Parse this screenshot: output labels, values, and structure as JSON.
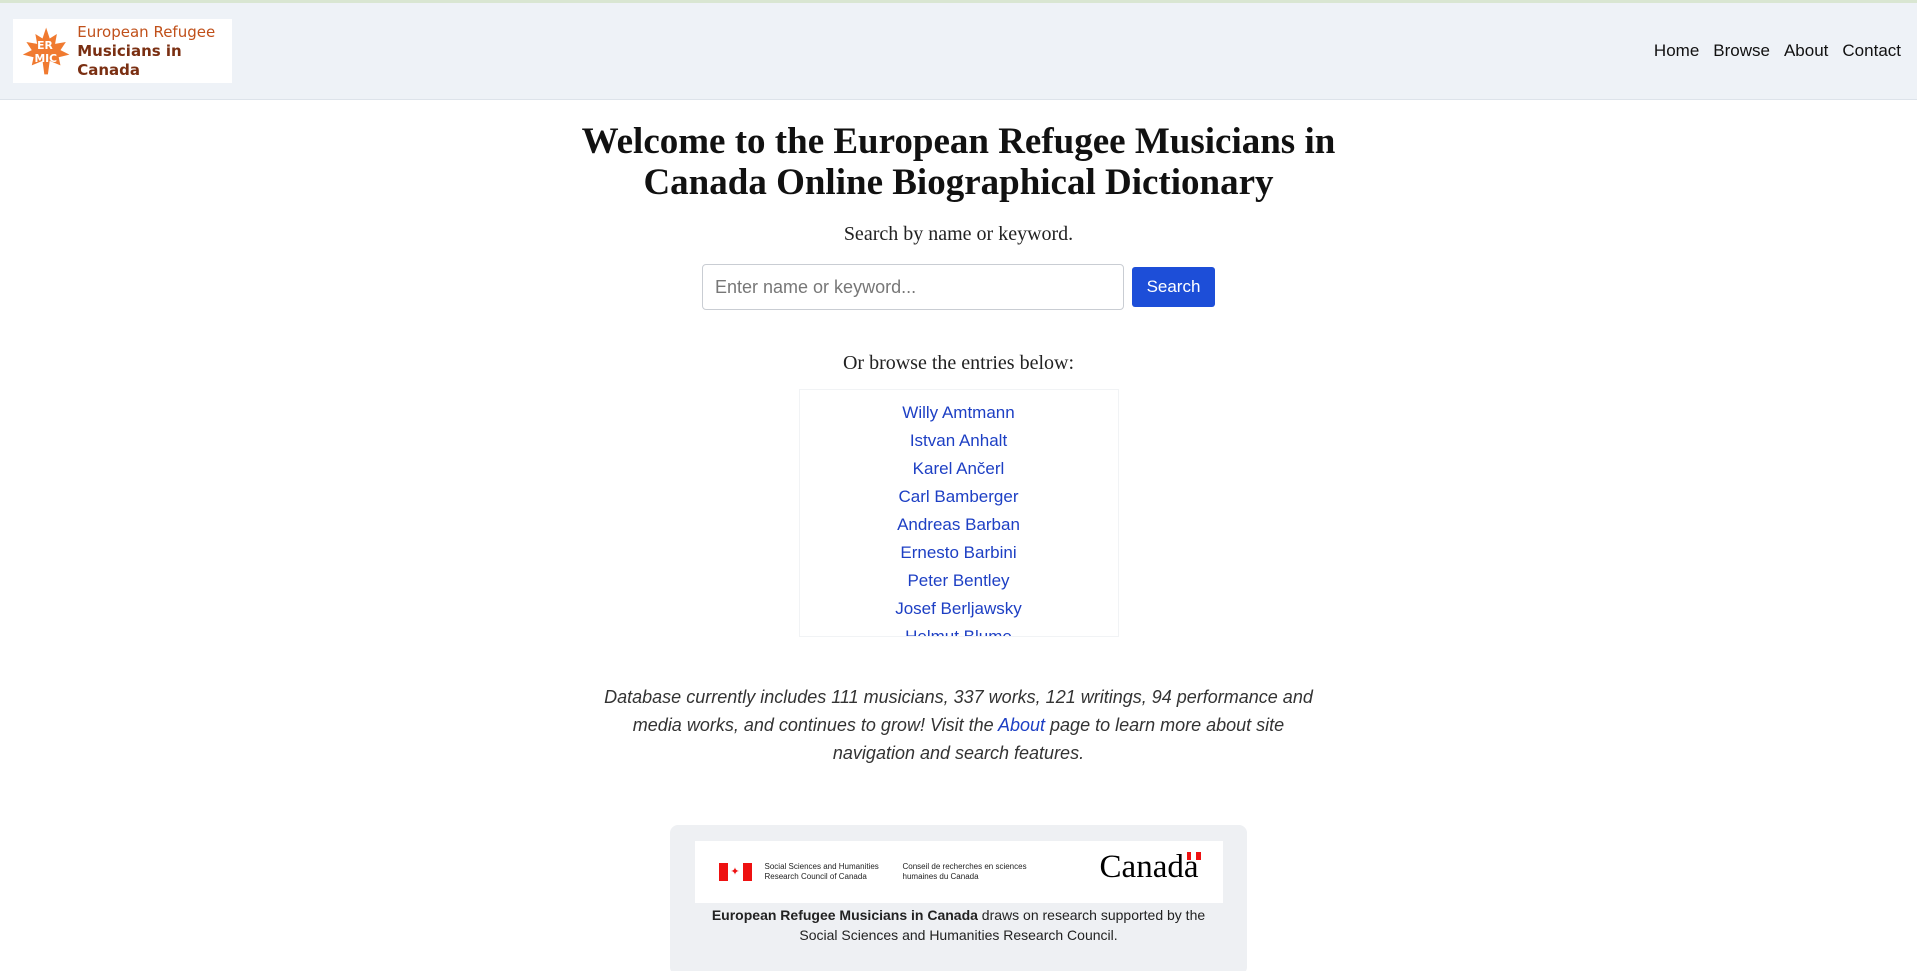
{
  "header": {
    "logo": {
      "mark": "ER MIC",
      "line1": "European Refugee",
      "line2": "Musicians in Canada"
    },
    "nav": [
      "Home",
      "Browse",
      "About",
      "Contact"
    ]
  },
  "main": {
    "title": "Welcome to the European Refugee Musicians in Canada Online Biographical Dictionary",
    "subtitle": "Search by name or keyword.",
    "search": {
      "placeholder": "Enter name or keyword...",
      "value": "",
      "button": "Search"
    },
    "browse_label": "Or browse the entries below:",
    "entries": [
      "Willy Amtmann",
      "Istvan Anhalt",
      "Karel Ančerl",
      "Carl Bamberger",
      "Andreas Barban",
      "Ernesto Barbini",
      "Peter Bentley",
      "Josef Berljawsky",
      "Helmut Blume"
    ],
    "stats": {
      "before": "Database currently includes 111 musicians, 337 works, 121 writings, 94 performance and media works, and continues to grow! Visit the ",
      "link": "About",
      "after": " page to learn more about site navigation and search features."
    }
  },
  "funder": {
    "sshrc_en": "Social Sciences and Humanities Research Council of Canada",
    "sshrc_fr": "Conseil de recherches en sciences humaines du Canada",
    "wordmark": "Canada",
    "text_bold": "European Refugee Musicians in Canada",
    "text_rest": " draws on research supported by the Social Sciences and Humanities Research Council."
  },
  "colors": {
    "accent": "#1d4ed8",
    "link": "#1d3fc4",
    "header_bg": "#eef2f7",
    "logo_orange": "#f07a30"
  },
  "icons": [
    "maple-leaf-logo-icon",
    "canada-flag-icon"
  ]
}
